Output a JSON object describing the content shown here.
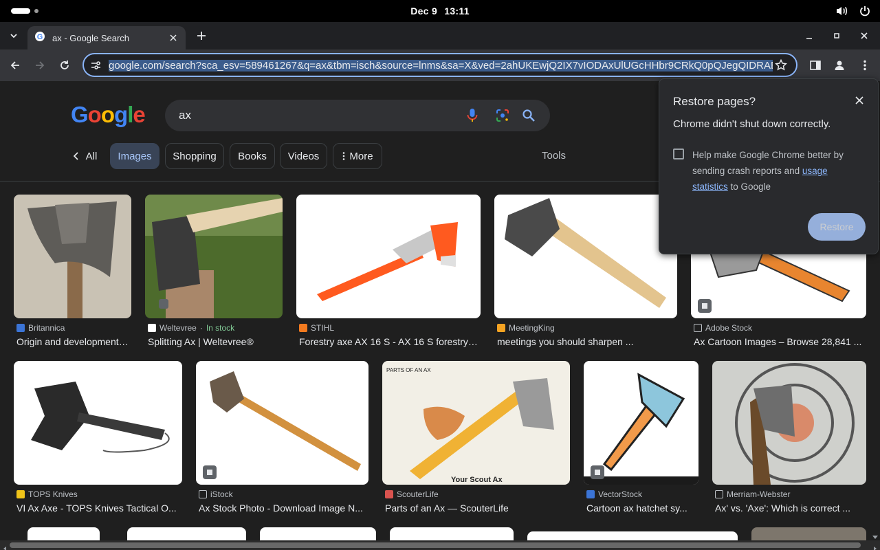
{
  "system_bar": {
    "date": "Dec 9",
    "time": "13:11"
  },
  "browser": {
    "tab_title": "ax - Google Search",
    "url": "google.com/search?sca_esv=589461267&q=ax&tbm=isch&source=lnms&sa=X&ved=2ahUKEwjQ2IX7vIODAxUlUGcHHbr9CRkQ0pQJegQIDRAB&biw"
  },
  "search": {
    "logo": "Google",
    "query": "ax"
  },
  "chips": {
    "all": "All",
    "images": "Images",
    "shopping": "Shopping",
    "books": "Books",
    "videos": "Videos",
    "more": "More",
    "tools": "Tools"
  },
  "results": [
    {
      "source": "Britannica",
      "title": "Origin and development…"
    },
    {
      "source": "Weltevree",
      "stock": "In stock",
      "title": "Splitting Ax | Weltevree®"
    },
    {
      "source": "STIHL",
      "title": "Forestry axe AX 16 S - AX 16 S forestry…"
    },
    {
      "source": "MeetingKing",
      "title": "meetings you should sharpen ..."
    },
    {
      "source": "Adobe Stock",
      "title": "Ax Cartoon Images – Browse 28,841 ..."
    },
    {
      "source": "TOPS Knives",
      "title": "VI Ax Axe - TOPS Knives Tactical O..."
    },
    {
      "source": "iStock",
      "title": "Ax Stock Photo - Download Image N..."
    },
    {
      "source": "ScouterLife",
      "title": "Parts of an Ax — ScouterLife"
    },
    {
      "source": "VectorStock",
      "title": "Cartoon ax hatchet sy..."
    },
    {
      "source": "Merriam-Webster",
      "title": "Ax' vs. 'Axe': Which is correct ..."
    }
  ],
  "image_text": {
    "scout_caption": "Your Scout Ax",
    "scout_parts_title": "PARTS OF AN AX"
  },
  "popup": {
    "title": "Restore pages?",
    "message": "Chrome didn't shut down correctly.",
    "checkbox_prefix": "Help make Google Chrome better by sending crash reports and ",
    "link": "usage statistics",
    "checkbox_suffix": " to Google",
    "button": "Restore"
  }
}
